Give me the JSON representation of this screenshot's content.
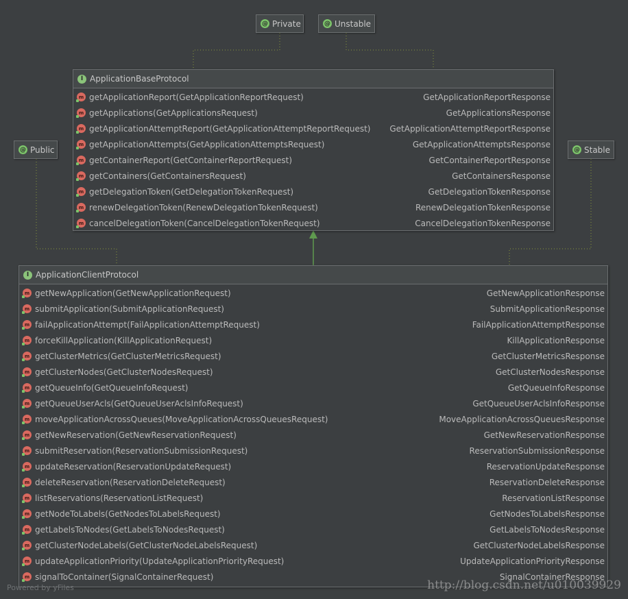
{
  "annotations": {
    "private": "Private",
    "unstable": "Unstable",
    "public": "Public",
    "stable": "Stable"
  },
  "base_interface": {
    "name": "ApplicationBaseProtocol",
    "methods": [
      {
        "sig": "getApplicationReport(GetApplicationReportRequest)",
        "ret": "GetApplicationReportResponse"
      },
      {
        "sig": "getApplications(GetApplicationsRequest)",
        "ret": "GetApplicationsResponse"
      },
      {
        "sig": "getApplicationAttemptReport(GetApplicationAttemptReportRequest)",
        "ret": "GetApplicationAttemptReportResponse"
      },
      {
        "sig": "getApplicationAttempts(GetApplicationAttemptsRequest)",
        "ret": "GetApplicationAttemptsResponse"
      },
      {
        "sig": "getContainerReport(GetContainerReportRequest)",
        "ret": "GetContainerReportResponse"
      },
      {
        "sig": "getContainers(GetContainersRequest)",
        "ret": "GetContainersResponse"
      },
      {
        "sig": "getDelegationToken(GetDelegationTokenRequest)",
        "ret": "GetDelegationTokenResponse"
      },
      {
        "sig": "renewDelegationToken(RenewDelegationTokenRequest)",
        "ret": "RenewDelegationTokenResponse"
      },
      {
        "sig": "cancelDelegationToken(CancelDelegationTokenRequest)",
        "ret": "CancelDelegationTokenResponse"
      }
    ]
  },
  "client_interface": {
    "name": "ApplicationClientProtocol",
    "methods": [
      {
        "sig": "getNewApplication(GetNewApplicationRequest)",
        "ret": "GetNewApplicationResponse"
      },
      {
        "sig": "submitApplication(SubmitApplicationRequest)",
        "ret": "SubmitApplicationResponse"
      },
      {
        "sig": "failApplicationAttempt(FailApplicationAttemptRequest)",
        "ret": "FailApplicationAttemptResponse"
      },
      {
        "sig": "forceKillApplication(KillApplicationRequest)",
        "ret": "KillApplicationResponse"
      },
      {
        "sig": "getClusterMetrics(GetClusterMetricsRequest)",
        "ret": "GetClusterMetricsResponse"
      },
      {
        "sig": "getClusterNodes(GetClusterNodesRequest)",
        "ret": "GetClusterNodesResponse"
      },
      {
        "sig": "getQueueInfo(GetQueueInfoRequest)",
        "ret": "GetQueueInfoResponse"
      },
      {
        "sig": "getQueueUserAcls(GetQueueUserAclsInfoRequest)",
        "ret": "GetQueueUserAclsInfoResponse"
      },
      {
        "sig": "moveApplicationAcrossQueues(MoveApplicationAcrossQueuesRequest)",
        "ret": "MoveApplicationAcrossQueuesResponse"
      },
      {
        "sig": "getNewReservation(GetNewReservationRequest)",
        "ret": "GetNewReservationResponse"
      },
      {
        "sig": "submitReservation(ReservationSubmissionRequest)",
        "ret": "ReservationSubmissionResponse"
      },
      {
        "sig": "updateReservation(ReservationUpdateRequest)",
        "ret": "ReservationUpdateResponse"
      },
      {
        "sig": "deleteReservation(ReservationDeleteRequest)",
        "ret": "ReservationDeleteResponse"
      },
      {
        "sig": "listReservations(ReservationListRequest)",
        "ret": "ReservationListResponse"
      },
      {
        "sig": "getNodeToLabels(GetNodesToLabelsRequest)",
        "ret": "GetNodesToLabelsResponse"
      },
      {
        "sig": "getLabelsToNodes(GetLabelsToNodesRequest)",
        "ret": "GetLabelsToNodesResponse"
      },
      {
        "sig": "getClusterNodeLabels(GetClusterNodeLabelsRequest)",
        "ret": "GetClusterNodeLabelsResponse"
      },
      {
        "sig": "updateApplicationPriority(UpdateApplicationPriorityRequest)",
        "ret": "UpdateApplicationPriorityResponse"
      },
      {
        "sig": "signalToContainer(SignalContainerRequest)",
        "ret": "SignalContainerResponse"
      }
    ]
  },
  "footer": {
    "powered_by": "Powered by yFiles",
    "watermark": "http://blog.csdn.net/u010039929"
  },
  "colors": {
    "background": "#3c3f41",
    "annotation_icon": "#7cc46a",
    "method_icon": "#d9695f",
    "inheritance_arrow": "#5f9a4f",
    "dotted_link": "#8a9a3a"
  },
  "icons": {
    "annotation": "at-sign-icon",
    "interface": "interface-i-icon",
    "method": "method-m-icon"
  }
}
